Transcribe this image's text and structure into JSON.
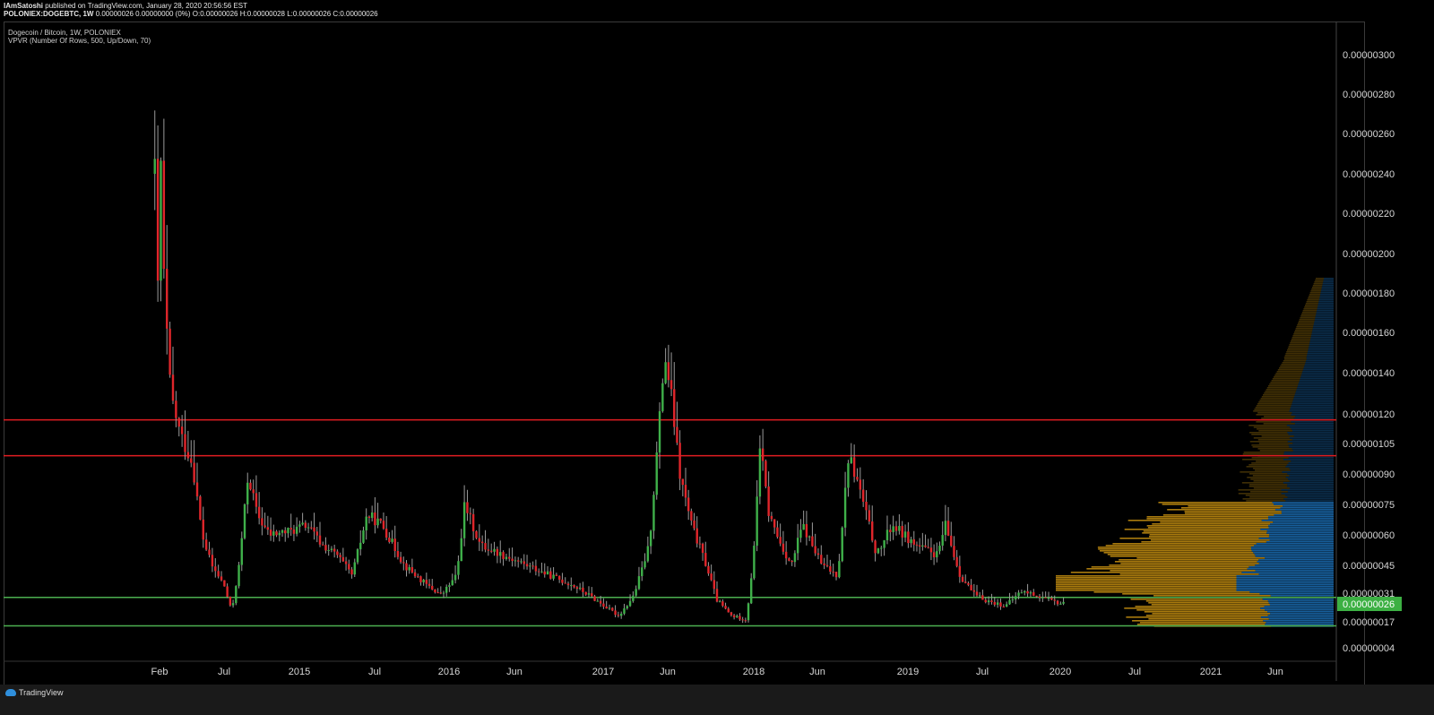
{
  "header": {
    "publisher": "IAmSatoshi",
    "published_text": "published on TradingView.com, January 28, 2020 20:56:56 EST",
    "symbol": "POLONIEX:DOGEBTC, 1W",
    "ohlc": "0.00000026 0.00000000 (0%) O:0.00000026 H:0.00000028 L:0.00000026 C:0.00000026"
  },
  "legend": {
    "title": "Dogecoin / Bitcoin, 1W, POLONIEX",
    "indicator": "VPVR (Number Of Rows, 500, Up/Down, 70)"
  },
  "footer": {
    "brand": "TradingView"
  },
  "colors": {
    "background": "#000000",
    "up_candle": "#3fb04a",
    "down_candle": "#e0262b",
    "wick": "#9a9a9a",
    "resistance_line": "#e11d22",
    "support_line": "#4caf50",
    "vpvr_up": "#1f7fd0",
    "vpvr_down": "#d49a12",
    "current_price_tag": "#3cb043"
  },
  "chart_data": {
    "type": "candlestick",
    "title": "Dogecoin / Bitcoin, 1W, POLONIEX",
    "xlabel": "",
    "ylabel": "",
    "x_ticks": [
      "Feb",
      "Jul",
      "2015",
      "Jul",
      "2016",
      "Jun",
      "2017",
      "Jun",
      "2018",
      "Jun",
      "2019",
      "Jul",
      "2020",
      "Jul",
      "2021",
      "Jun"
    ],
    "y_ticks": [
      "0.00000300",
      "0.00000280",
      "0.00000260",
      "0.00000240",
      "0.00000220",
      "0.00000200",
      "0.00000180",
      "0.00000160",
      "0.00000140",
      "0.00000120",
      "0.00000105",
      "0.00000090",
      "0.00000075",
      "0.00000060",
      "0.00000045",
      "0.00000031",
      "0.00000026",
      "0.00000017",
      "0.00000004"
    ],
    "current_price_label": "0.00000026",
    "key_prices": [
      {
        "name": "resistance-1",
        "value": 1.17e-06,
        "color": "#e11d22"
      },
      {
        "name": "resistance-2",
        "value": 9.9e-07,
        "color": "#e11d22"
      },
      {
        "name": "support-1",
        "value": 2.9e-07,
        "color": "#4caf50"
      },
      {
        "name": "support-2",
        "value": 1.5e-07,
        "color": "#4caf50"
      }
    ],
    "price_path": [
      {
        "t": 2014.06,
        "p": 2.4e-06
      },
      {
        "t": 2014.08,
        "p": 1.8e-06
      },
      {
        "t": 2014.1,
        "p": 2.5e-06
      },
      {
        "t": 2014.12,
        "p": 1.8e-06
      },
      {
        "t": 2014.16,
        "p": 1.3e-06
      },
      {
        "t": 2014.22,
        "p": 1.1e-06
      },
      {
        "t": 2014.3,
        "p": 9.5e-07
      },
      {
        "t": 2014.36,
        "p": 6e-07
      },
      {
        "t": 2014.42,
        "p": 4.5e-07
      },
      {
        "t": 2014.5,
        "p": 3.5e-07
      },
      {
        "t": 2014.55,
        "p": 2.2e-07
      },
      {
        "t": 2014.6,
        "p": 4.5e-07
      },
      {
        "t": 2014.66,
        "p": 9e-07
      },
      {
        "t": 2014.72,
        "p": 7e-07
      },
      {
        "t": 2014.8,
        "p": 6e-07
      },
      {
        "t": 2014.95,
        "p": 6.2e-07
      },
      {
        "t": 2015.05,
        "p": 6.5e-07
      },
      {
        "t": 2015.15,
        "p": 5.5e-07
      },
      {
        "t": 2015.25,
        "p": 5e-07
      },
      {
        "t": 2015.35,
        "p": 4e-07
      },
      {
        "t": 2015.45,
        "p": 7e-07
      },
      {
        "t": 2015.55,
        "p": 6.5e-07
      },
      {
        "t": 2015.7,
        "p": 4.5e-07
      },
      {
        "t": 2015.85,
        "p": 3.5e-07
      },
      {
        "t": 2015.95,
        "p": 3e-07
      },
      {
        "t": 2016.05,
        "p": 4e-07
      },
      {
        "t": 2016.1,
        "p": 7.5e-07
      },
      {
        "t": 2016.2,
        "p": 5.5e-07
      },
      {
        "t": 2016.35,
        "p": 5e-07
      },
      {
        "t": 2016.5,
        "p": 4.5e-07
      },
      {
        "t": 2016.65,
        "p": 4e-07
      },
      {
        "t": 2016.8,
        "p": 3.5e-07
      },
      {
        "t": 2016.95,
        "p": 2.8e-07
      },
      {
        "t": 2017.1,
        "p": 2e-07
      },
      {
        "t": 2017.2,
        "p": 3e-07
      },
      {
        "t": 2017.3,
        "p": 5.5e-07
      },
      {
        "t": 2017.36,
        "p": 1.1e-06
      },
      {
        "t": 2017.4,
        "p": 1.5e-06
      },
      {
        "t": 2017.45,
        "p": 1.25e-06
      },
      {
        "t": 2017.5,
        "p": 9e-07
      },
      {
        "t": 2017.58,
        "p": 6.5e-07
      },
      {
        "t": 2017.68,
        "p": 4.5e-07
      },
      {
        "t": 2017.75,
        "p": 2.8e-07
      },
      {
        "t": 2017.85,
        "p": 2e-07
      },
      {
        "t": 2017.95,
        "p": 1.8e-07
      },
      {
        "t": 2018.0,
        "p": 5e-07
      },
      {
        "t": 2018.04,
        "p": 1.05e-06
      },
      {
        "t": 2018.1,
        "p": 7e-07
      },
      {
        "t": 2018.18,
        "p": 5.5e-07
      },
      {
        "t": 2018.25,
        "p": 4.5e-07
      },
      {
        "t": 2018.32,
        "p": 6.5e-07
      },
      {
        "t": 2018.45,
        "p": 4.5e-07
      },
      {
        "t": 2018.55,
        "p": 4e-07
      },
      {
        "t": 2018.62,
        "p": 1e-06
      },
      {
        "t": 2018.7,
        "p": 8e-07
      },
      {
        "t": 2018.8,
        "p": 5e-07
      },
      {
        "t": 2018.9,
        "p": 6.5e-07
      },
      {
        "t": 2019.05,
        "p": 5.5e-07
      },
      {
        "t": 2019.2,
        "p": 5e-07
      },
      {
        "t": 2019.25,
        "p": 6.5e-07
      },
      {
        "t": 2019.35,
        "p": 4e-07
      },
      {
        "t": 2019.45,
        "p": 3e-07
      },
      {
        "t": 2019.55,
        "p": 2.7e-07
      },
      {
        "t": 2019.65,
        "p": 2.5e-07
      },
      {
        "t": 2019.75,
        "p": 3.2e-07
      },
      {
        "t": 2019.85,
        "p": 3e-07
      },
      {
        "t": 2019.95,
        "p": 2.7e-07
      },
      {
        "t": 2020.03,
        "p": 2.6e-07
      }
    ]
  }
}
